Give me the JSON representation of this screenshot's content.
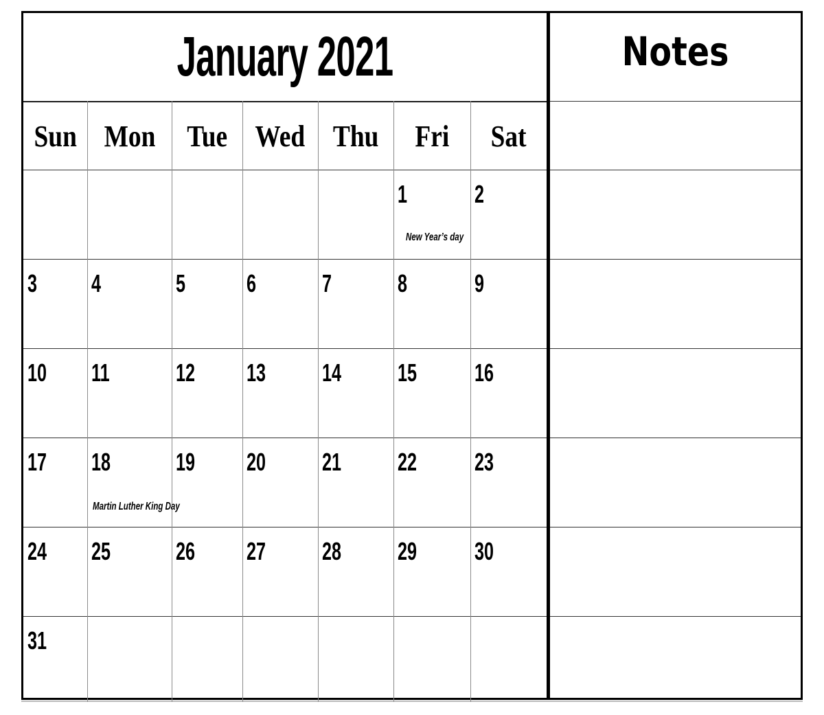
{
  "calendar": {
    "title": "January 2021",
    "month": "January",
    "year": 2021,
    "weekdays": [
      "Sun",
      "Mon",
      "Tue",
      "Wed",
      "Thu",
      "Fri",
      "Sat"
    ],
    "weeks": [
      [
        null,
        null,
        null,
        null,
        null,
        1,
        2
      ],
      [
        3,
        4,
        5,
        6,
        7,
        8,
        9
      ],
      [
        10,
        11,
        12,
        13,
        14,
        15,
        16
      ],
      [
        17,
        18,
        19,
        20,
        21,
        22,
        23
      ],
      [
        24,
        25,
        26,
        27,
        28,
        29,
        30
      ],
      [
        31,
        null,
        null,
        null,
        null,
        null,
        null
      ]
    ],
    "holidays": [
      {
        "day": 1,
        "label": "New Year’s day"
      },
      {
        "day": 18,
        "label": "Martin Luther King Day"
      }
    ]
  },
  "notes": {
    "title": "Notes",
    "lines": [
      "",
      "",
      "",
      "",
      "",
      "",
      ""
    ]
  }
}
